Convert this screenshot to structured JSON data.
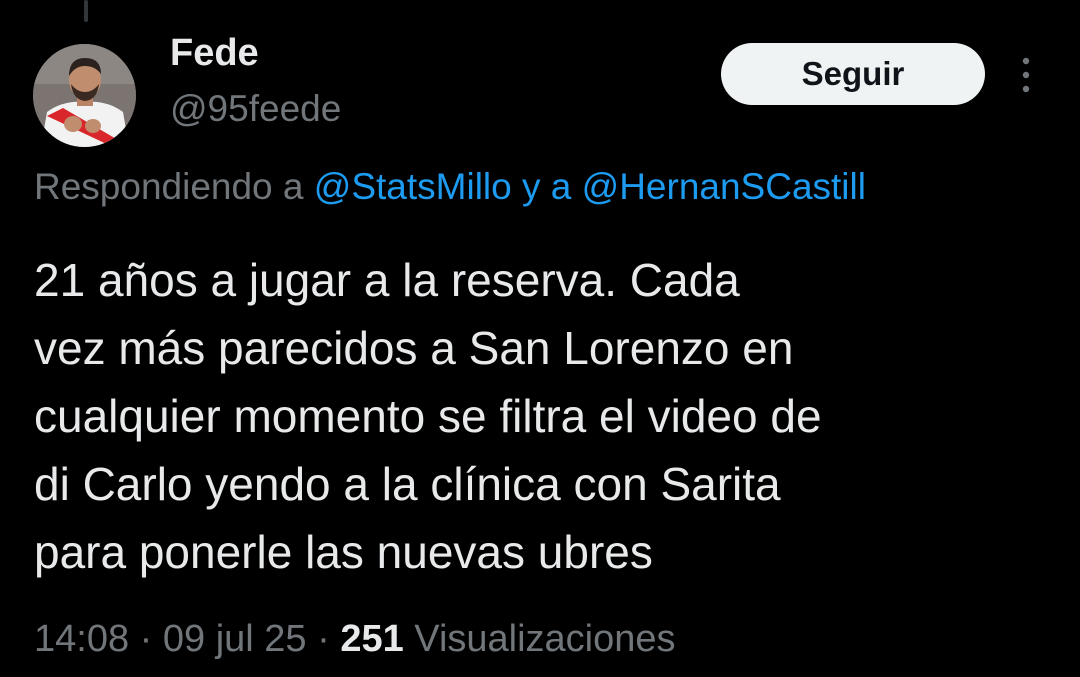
{
  "author": {
    "display_name": "Fede",
    "handle": "@95feede",
    "avatar_icon": "profile-photo"
  },
  "actions": {
    "follow_label": "Seguir",
    "more_icon": "vertical-ellipsis-icon"
  },
  "reply_context": {
    "prefix": "Respondiendo a ",
    "mention_1": "@StatsMillo",
    "joiner": " y a ",
    "mention_2": "@HernanSCastill"
  },
  "tweet": {
    "lines": [
      "21 años a jugar a la reserva. Cada",
      "vez más parecidos a San Lorenzo en",
      "cualquier momento se filtra el video de",
      "di Carlo yendo a la clínica con Sarita",
      "para ponerle las nuevas ubres"
    ]
  },
  "meta": {
    "time": "14:08",
    "sep1": " · ",
    "date": "09 jul 25",
    "sep2": " · ",
    "views_count": "251",
    "views_label": " Visualizaciones"
  },
  "colors": {
    "background": "#000000",
    "text_primary": "#e7e9ea",
    "text_secondary": "#71767b",
    "link": "#1d9bf0",
    "follow_bg": "#eff3f4",
    "follow_text": "#0f1419"
  }
}
